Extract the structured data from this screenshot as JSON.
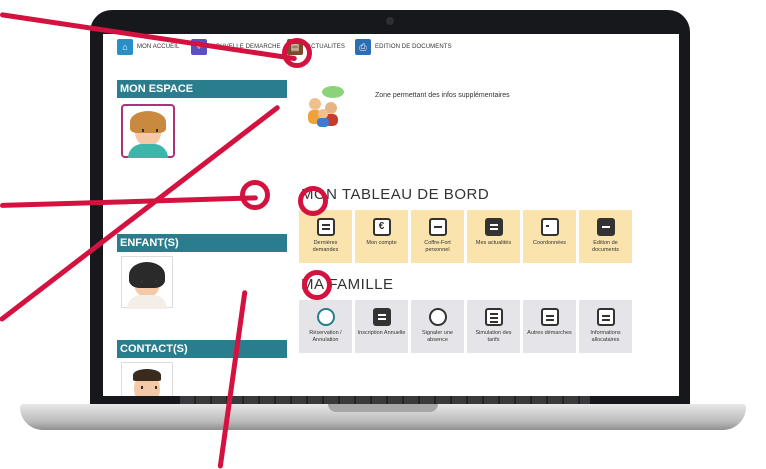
{
  "topnav": {
    "items": [
      {
        "label": "MON ACCUEIL",
        "icon": "home-icon",
        "color": "#2a8fc4"
      },
      {
        "label": "NOUVELLE DEMARCHE",
        "icon": "document-add-icon",
        "color": "#5a4fc4"
      },
      {
        "label": "ACTUALITES",
        "icon": "news-icon",
        "color": "#7a4a2a"
      },
      {
        "label": "EDITION DE DOCUMENTS",
        "icon": "printer-icon",
        "color": "#2a6fb4"
      }
    ]
  },
  "sidebar": {
    "mon_espace": "MON ESPACE",
    "enfants": "ENFANT(S)",
    "contacts": "CONTACT(S)"
  },
  "main": {
    "info_text": "Zone permettant des infos supplémentaires",
    "tableau_title": "MON TABLEAU DE BORD",
    "famille_title": "MA FAMILLE",
    "tableau_tiles": [
      {
        "label": "Dernières demandes",
        "icon": "document-list-icon"
      },
      {
        "label": "Mon compte",
        "icon": "euro-icon"
      },
      {
        "label": "Coffre-Fort personnel",
        "icon": "safe-icon"
      },
      {
        "label": "Mes actualités",
        "icon": "news-icon"
      },
      {
        "label": "Coordonnées",
        "icon": "contact-card-icon"
      },
      {
        "label": "Edition de documents",
        "icon": "printer-icon"
      }
    ],
    "famille_tiles": [
      {
        "label": "Réservation / Annulation",
        "icon": "check-circle-icon"
      },
      {
        "label": "Inscription Annuelle",
        "icon": "form-icon"
      },
      {
        "label": "Signaler une absence",
        "icon": "absence-icon"
      },
      {
        "label": "Simulation des tarifs",
        "icon": "calculator-icon"
      },
      {
        "label": "Autres démarches",
        "icon": "document-icon"
      },
      {
        "label": "Informations allocataires",
        "icon": "id-card-icon"
      }
    ]
  },
  "colors": {
    "accent": "#2a7d8c",
    "callout": "#d4123f",
    "tile_dashboard": "#fbe3ad",
    "tile_family": "#e5e4e8"
  }
}
